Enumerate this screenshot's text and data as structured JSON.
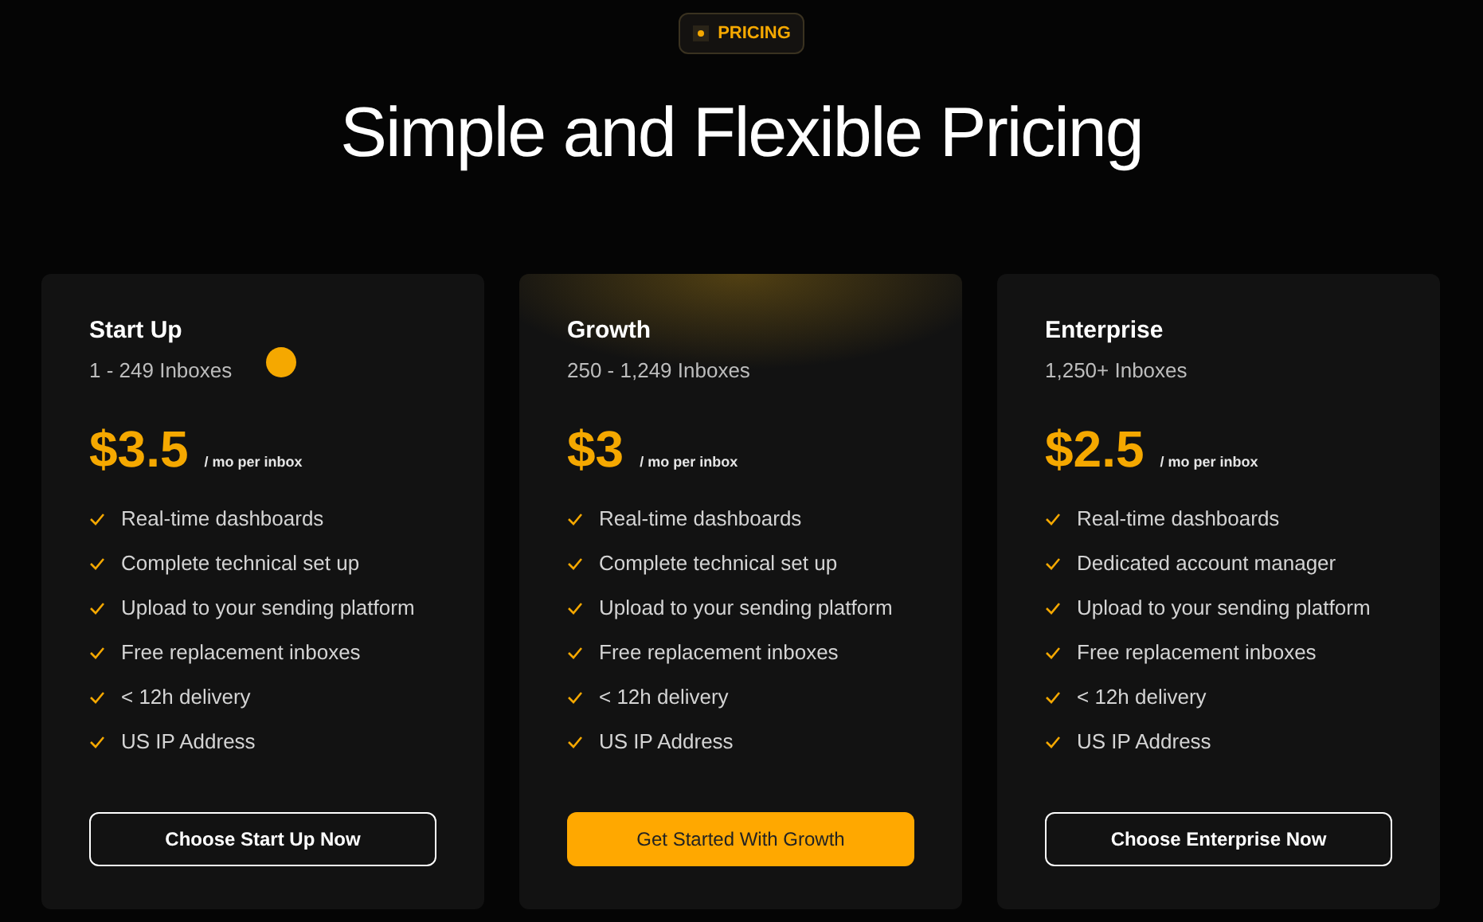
{
  "badge": {
    "label": "PRICING"
  },
  "title": "Simple and Flexible Pricing",
  "plans": [
    {
      "name": "Start Up",
      "range": "1 - 249 Inboxes",
      "price": "$3.5",
      "unit": "/ mo per inbox",
      "featured": false,
      "features": [
        "Real-time dashboards",
        "Complete technical set up",
        "Upload to your sending platform",
        "Free replacement inboxes",
        "< 12h delivery",
        "US IP Address"
      ],
      "button": "Choose Start Up Now"
    },
    {
      "name": "Growth",
      "range": "250 - 1,249 Inboxes",
      "price": "$3",
      "unit": "/ mo per inbox",
      "featured": true,
      "features": [
        "Real-time dashboards",
        "Complete technical set up",
        "Upload to your sending platform",
        "Free replacement inboxes",
        "< 12h delivery",
        "US IP Address"
      ],
      "button": "Get Started With Growth"
    },
    {
      "name": "Enterprise",
      "range": "1,250+ Inboxes",
      "price": "$2.5",
      "unit": "/ mo per inbox",
      "featured": false,
      "features": [
        "Real-time dashboards",
        "Dedicated account manager",
        "Upload to your sending platform",
        "Free replacement inboxes",
        "< 12h delivery",
        "US IP Address"
      ],
      "button": "Choose Enterprise Now"
    }
  ]
}
